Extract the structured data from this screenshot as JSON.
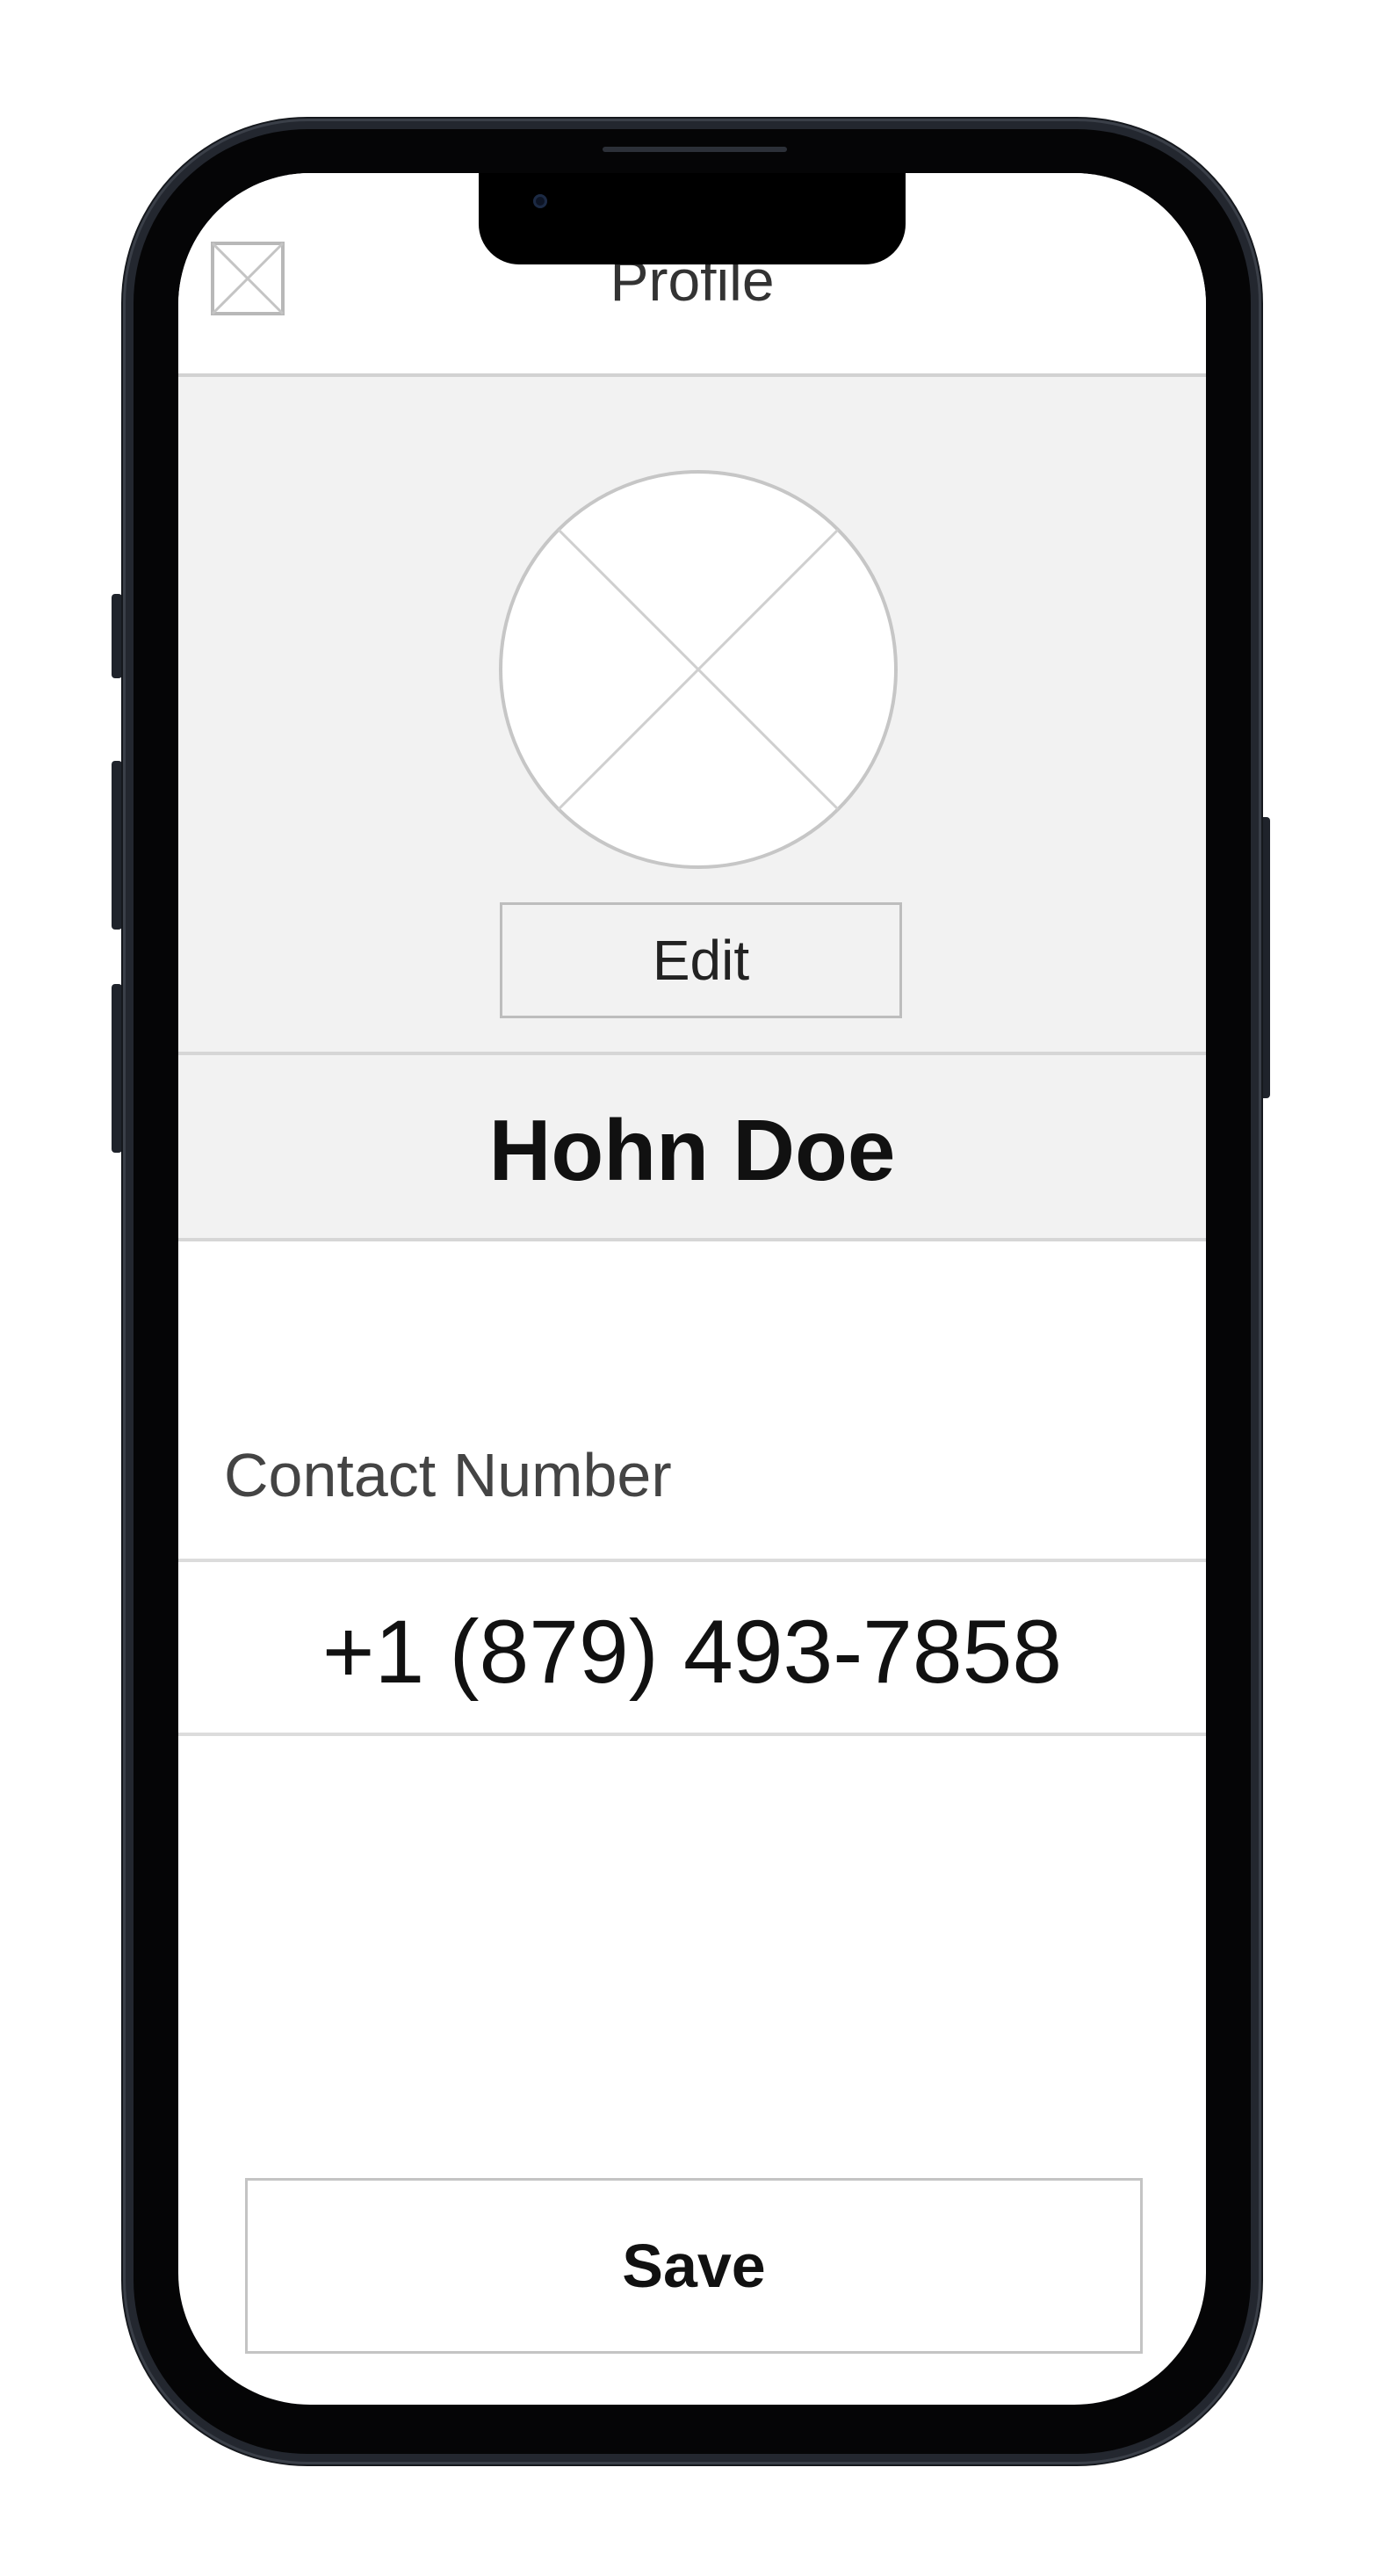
{
  "header": {
    "title": "Profile",
    "close_icon": "close-placeholder-icon"
  },
  "profile": {
    "avatar_icon": "avatar-placeholder-icon",
    "edit_label": "Edit",
    "name": "Hohn Doe"
  },
  "contact": {
    "label": "Contact Number",
    "number": "+1 (879) 493-7858"
  },
  "footer": {
    "save_label": "Save"
  },
  "colors": {
    "section_background": "#f2f2f2",
    "divider": "#d6d6d6",
    "phone_frame": "#23272f"
  }
}
